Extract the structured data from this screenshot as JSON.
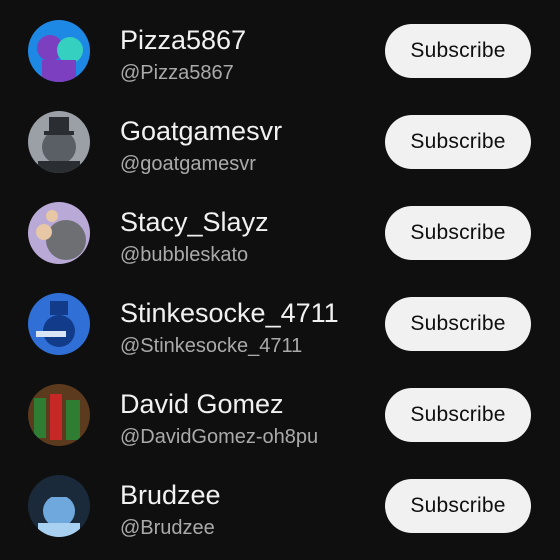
{
  "channels": [
    {
      "name": "Pizza5867",
      "handle": "@Pizza5867",
      "button": "Subscribe",
      "avatar_colors": [
        "#1e88e5",
        "#7b3fbf",
        "#35d0c0"
      ]
    },
    {
      "name": "Goatgamesvr",
      "handle": "@goatgamesvr",
      "button": "Subscribe",
      "avatar_colors": [
        "#5a5f66",
        "#2a2d31",
        "#9aa0a6"
      ]
    },
    {
      "name": "Stacy_Slayz",
      "handle": "@bubbleskato",
      "button": "Subscribe",
      "avatar_colors": [
        "#b9a9d6",
        "#6d6f73",
        "#e7c7a6"
      ]
    },
    {
      "name": "Stinkesocke_4711",
      "handle": "@Stinkesocke_4711",
      "button": "Subscribe",
      "avatar_colors": [
        "#2f6fd6",
        "#123b8a",
        "#d9e4f5"
      ]
    },
    {
      "name": "David Gomez",
      "handle": "@DavidGomez-oh8pu",
      "button": "Subscribe",
      "avatar_colors": [
        "#5b3a1e",
        "#2e7d32",
        "#c62828"
      ]
    },
    {
      "name": "Brudzee",
      "handle": "@Brudzee",
      "button": "Subscribe",
      "avatar_colors": [
        "#6fa8dc",
        "#1b2a3a",
        "#a8d0f0"
      ]
    }
  ]
}
